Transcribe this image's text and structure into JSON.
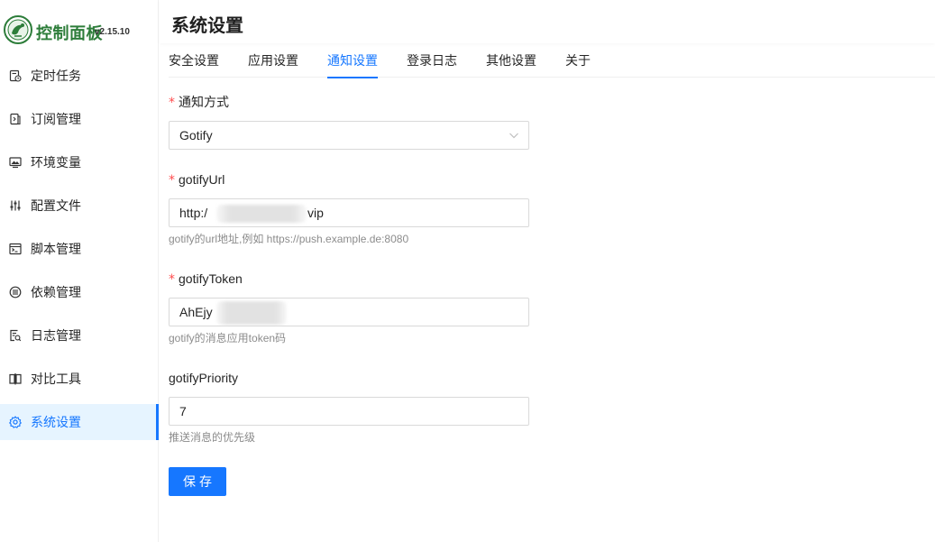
{
  "brand": {
    "name": "控制面板",
    "version": "v2.15.10"
  },
  "sidebar": {
    "items": [
      {
        "label": "定时任务",
        "icon": "schedule-icon"
      },
      {
        "label": "订阅管理",
        "icon": "subscription-icon"
      },
      {
        "label": "环境变量",
        "icon": "environment-icon"
      },
      {
        "label": "配置文件",
        "icon": "config-icon"
      },
      {
        "label": "脚本管理",
        "icon": "script-icon"
      },
      {
        "label": "依赖管理",
        "icon": "dependency-icon"
      },
      {
        "label": "日志管理",
        "icon": "log-icon"
      },
      {
        "label": "对比工具",
        "icon": "diff-icon"
      },
      {
        "label": "系统设置",
        "icon": "gear-icon",
        "active": true
      }
    ]
  },
  "page": {
    "title": "系统设置"
  },
  "tabs": [
    {
      "label": "安全设置"
    },
    {
      "label": "应用设置"
    },
    {
      "label": "通知设置",
      "active": true
    },
    {
      "label": "登录日志"
    },
    {
      "label": "其他设置"
    },
    {
      "label": "关于"
    }
  ],
  "form": {
    "notify_method": {
      "label": "通知方式",
      "required": true,
      "value": "Gotify"
    },
    "gotify_url": {
      "label": "gotifyUrl",
      "required": true,
      "value_prefix": "http:/",
      "value_suffix": "vip",
      "help": "gotify的url地址,例如 https://push.example.de:8080"
    },
    "gotify_token": {
      "label": "gotifyToken",
      "required": true,
      "value_prefix": "AhEjy",
      "help": "gotify的消息应用token码"
    },
    "gotify_priority": {
      "label": "gotifyPriority",
      "required": false,
      "value": "7",
      "help": "推送消息的优先级"
    },
    "save_label": "保存"
  },
  "colors": {
    "primary": "#1677ff",
    "brand_green": "#2d7d3a",
    "required": "#ff4d4f",
    "active_bg": "#e6f4ff"
  }
}
